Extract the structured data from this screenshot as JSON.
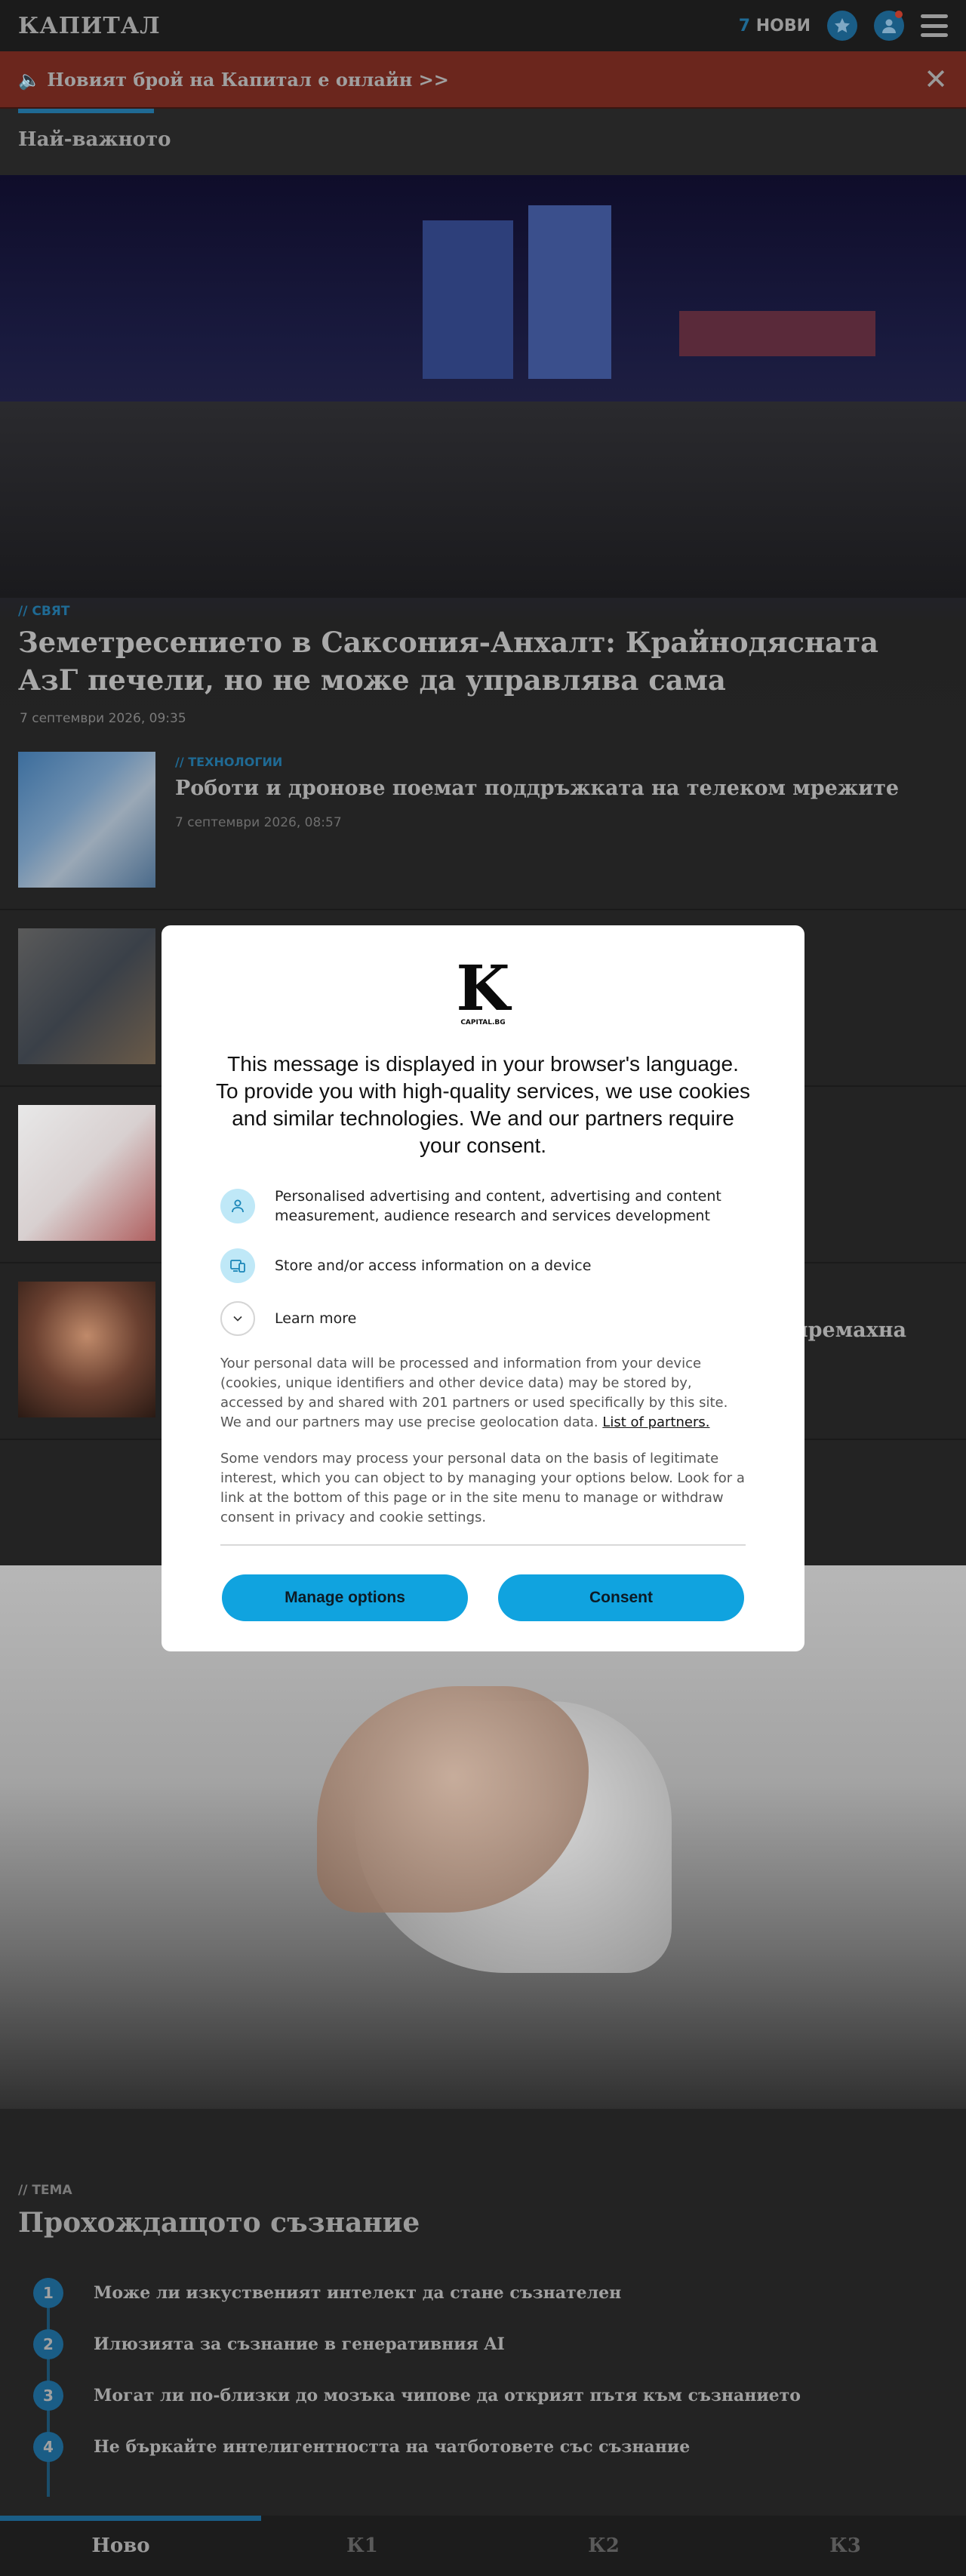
{
  "header": {
    "logo": "КАПИТАЛ",
    "news_count": "7",
    "news_label": "НОВИ"
  },
  "promo": {
    "text": "🔈 Новият брой на Капитал е онлайн >>",
    "close": "✕"
  },
  "section": {
    "title": "Най-важното"
  },
  "hero": {
    "tag": "// СВЯТ",
    "title": "Земетресението в Саксония-Анхалт: Крайнодясната АзГ печели, но не може да управлява сама",
    "date": "7 септември 2026, 09:35"
  },
  "articles": [
    {
      "tag": "// ТЕХНОЛОГИИ",
      "title": "Роботи и дронове поемат поддръжката на телеком мрежите",
      "date": "7 септември 2026, 08:57"
    },
    {
      "tag": "",
      "title": "",
      "date": ""
    },
    {
      "tag": "",
      "title": "",
      "date": ""
    },
    {
      "tag": "",
      "title": "да премахна",
      "date": ""
    }
  ],
  "topic": {
    "tag": "// ТЕМА",
    "title": "Прохождащото съзнание",
    "items": [
      {
        "num": "1",
        "text": "Може ли изкуственият интелект да стане съзнателен"
      },
      {
        "num": "2",
        "text": "Илюзията за съзнание в генеративния AI"
      },
      {
        "num": "3",
        "text": "Могат ли по-близки до мозъка чипове да открият пътя към съзнанието"
      },
      {
        "num": "4",
        "text": "Не бъркайте интелигентността на чатботовете със съзнание"
      }
    ]
  },
  "bottom_nav": [
    "Ново",
    "К1",
    "К2",
    "К3"
  ],
  "consent": {
    "logo_letter": "K",
    "logo_domain": "CAPITAL.BG",
    "heading": "This message is displayed in your browser's language. To provide you with high-quality services, we use cookies and similar technologies. We and our partners require your consent.",
    "purposes": [
      {
        "icon": "person-icon",
        "text": "Personalised advertising and content, advertising and content measurement, audience research and services development"
      },
      {
        "icon": "devices-icon",
        "text": "Store and/or access information on a device"
      },
      {
        "icon": "chevron-down-icon",
        "text": "Learn more"
      }
    ],
    "body1": "Your personal data will be processed and information from your device (cookies, unique identifiers and other device data) may be stored by, accessed by and shared with 201 partners or used specifically by this site. We and our partners may use precise geolocation data.",
    "partners_link": "List of partners.",
    "body2": "Some vendors may process your personal data on the basis of legitimate interest, which you can object to by managing your options below. Look for a link at the bottom of this page or in the site menu to manage or withdraw consent in privacy and cookie settings.",
    "manage_label": "Manage options",
    "consent_label": "Consent"
  },
  "colors": {
    "accent": "#10a3df",
    "brand_blue": "#1a5d86",
    "promo_red": "#6b261d"
  }
}
